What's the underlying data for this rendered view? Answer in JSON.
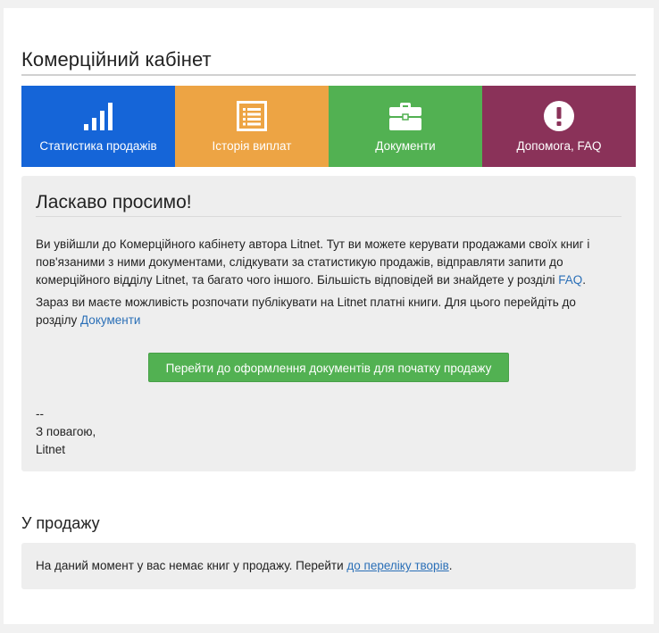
{
  "page": {
    "title": "Комерційний кабінет"
  },
  "tiles": [
    {
      "label": "Статистика продажів",
      "icon": "bar-chart-icon",
      "color": "#1565d8"
    },
    {
      "label": "Історія виплат",
      "icon": "list-document-icon",
      "color": "#eda444"
    },
    {
      "label": "Документи",
      "icon": "briefcase-icon",
      "color": "#52b152"
    },
    {
      "label": "Допомога, FAQ",
      "icon": "exclamation-circle-icon",
      "color": "#8a3259"
    }
  ],
  "welcome": {
    "title": "Ласкаво просимо!",
    "p1_text": "Ви увійшли до Комерційного кабінету автора Litnet. Тут ви можете керувати продажами своїх книг і пов'язаними з ними документами, слідкувати за статистикую продажів, відправляти запити до комерційного відділу Litnet, та багато чого іншого. Більшість відповідей ви знайдете у розділі ",
    "p1_link": "FAQ",
    "p1_end": ".",
    "p2_text": "Зараз ви маєте можливість розпочати публікувати на Litnet платні книги. Для цього перейдіть до розділу ",
    "p2_link": "Документи",
    "button_label": "Перейти до оформлення документів для початку продажу",
    "sign_dash": "--",
    "sign_regards": "З повагою,",
    "sign_name": "Litnet"
  },
  "sale": {
    "title": "У продажу",
    "text": "На даний момент у вас немає книг у продажу. Перейти ",
    "link": "до переліку творів",
    "end": "."
  }
}
